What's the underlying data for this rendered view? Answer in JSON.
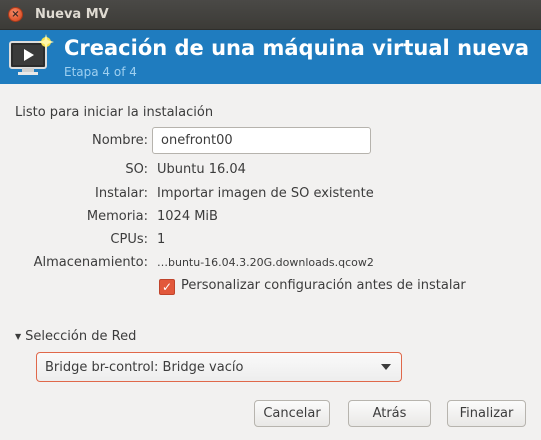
{
  "window": {
    "title": "Nueva MV",
    "close_glyph": "×"
  },
  "header": {
    "title": "Creación de una máquina virtual nueva",
    "subtitle": "Etapa 4 of 4",
    "icon": "new-vm-monitor-icon"
  },
  "summary": {
    "heading": "Listo para iniciar la instalación",
    "name_label": "Nombre:",
    "name_value": "onefront00",
    "os_label": "SO:",
    "os_value": "Ubuntu 16.04",
    "install_label": "Instalar:",
    "install_value": "Importar imagen de SO existente",
    "memory_label": "Memoria:",
    "memory_value": "1024 MiB",
    "cpus_label": "CPUs:",
    "cpus_value": "1",
    "storage_label": "Almacenamiento:",
    "storage_value": "…buntu-16.04.3.20G.downloads.qcow2"
  },
  "customize": {
    "label": "Personalizar configuración antes de instalar",
    "checked": true,
    "check_glyph": "✓"
  },
  "network": {
    "expander_label": "Selección de Red",
    "expander_glyph": "▼",
    "selected": "Bridge br-control: Bridge vacío"
  },
  "buttons": {
    "cancel": "Cancelar",
    "back": "Atrás",
    "finish": "Finalizar"
  },
  "colors": {
    "banner": "#1f7cbf",
    "accent": "#e2583b"
  }
}
